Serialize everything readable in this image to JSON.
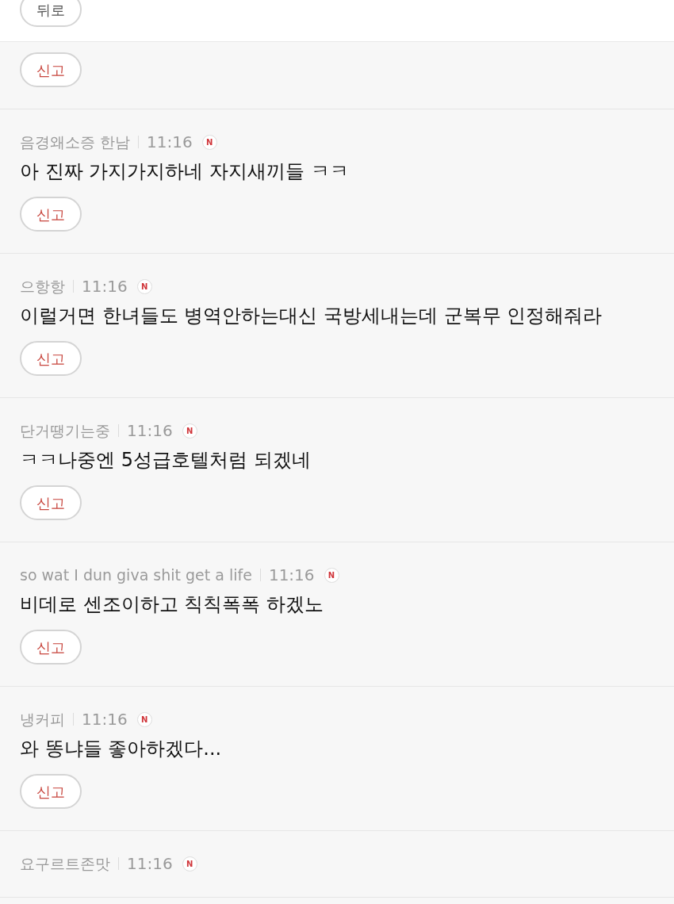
{
  "top_bar": {
    "back_button": "뒤로"
  },
  "comments": [
    {
      "report_button": "신고"
    },
    {
      "author": "음경왜소증 한남",
      "time": "11:16",
      "badge": "N",
      "body": "아 진짜 가지가지하네 자지새끼들 ㅋㅋ",
      "report_button": "신고"
    },
    {
      "author": "으항항",
      "time": "11:16",
      "badge": "N",
      "body": "이럴거면 한녀들도 병역안하는대신 국방세내는데 군복무 인정해줘라",
      "report_button": "신고"
    },
    {
      "author": "단거땡기는중",
      "time": "11:16",
      "badge": "N",
      "body": "ㅋㅋ나중엔 5성급호텔처럼 되겠네",
      "report_button": "신고"
    },
    {
      "author": "so wat I dun giva shit get a life",
      "time": "11:16",
      "badge": "N",
      "body": "비데로 센조이하고 칙칙폭폭 하겠노",
      "report_button": "신고"
    },
    {
      "author": "냉커피",
      "time": "11:16",
      "badge": "N",
      "body": "와 똥냐들 좋아하겠다...",
      "report_button": "신고"
    },
    {
      "author": "요구르트존맛",
      "time": "11:16",
      "badge": "N"
    }
  ]
}
